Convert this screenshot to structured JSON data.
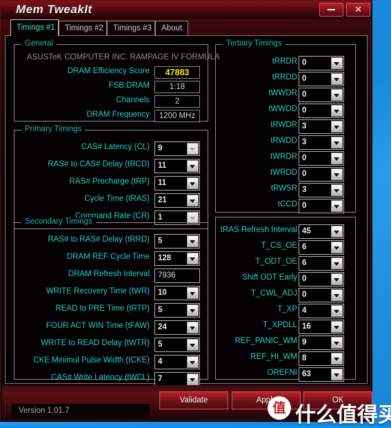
{
  "window": {
    "title": "Mem TweakIt",
    "minimize_label": "",
    "close_label": "✕",
    "version": "Version 1.01.7"
  },
  "tabs": [
    {
      "label": "Timings #1",
      "active": true
    },
    {
      "label": "Timings #2",
      "active": false
    },
    {
      "label": "Timings #3",
      "active": false
    },
    {
      "label": "About",
      "active": false
    }
  ],
  "general": {
    "legend": "General",
    "motherboard": "ASUSTeK COMPUTER INC.  RAMPAGE IV FORMULA",
    "rows": [
      {
        "label": "DRAM Efficiency Score",
        "value": "47883",
        "accent": true
      },
      {
        "label": "FSB:DRAM",
        "value": "1:18",
        "accent": false
      },
      {
        "label": "Channels",
        "value": "2",
        "accent": false
      },
      {
        "label": "DRAM Frequency",
        "value": "1200 MHz",
        "accent": false
      }
    ]
  },
  "primary": {
    "legend": "Primary Timings",
    "rows": [
      {
        "label": "CAS# Latency (CL)",
        "value": "9",
        "disabled": true
      },
      {
        "label": "RAS# to CAS# Delay (tRCD)",
        "value": "11",
        "disabled": false
      },
      {
        "label": "RAS# Precharge (tRP)",
        "value": "11",
        "disabled": false
      },
      {
        "label": "Cycle Time (tRAS)",
        "value": "21",
        "disabled": false
      },
      {
        "label": "Command Rate (CR)",
        "value": "1",
        "disabled": true
      }
    ]
  },
  "secondary": {
    "legend": "Secondary Timings",
    "rows": [
      {
        "label": "RAS# to RAS# Delay (tRRD)",
        "value": "5",
        "type": "combo"
      },
      {
        "label": "DRAM REF Cycle Time",
        "value": "128",
        "type": "combo"
      },
      {
        "label": "DRAM Refresh Interval",
        "value": "7936",
        "type": "text"
      },
      {
        "label": "WRITE Recovery Time (tWR)",
        "value": "10",
        "type": "combo"
      },
      {
        "label": "READ to PRE Time (tRTP)",
        "value": "5",
        "type": "combo"
      },
      {
        "label": "FOUR ACT WIN Time (tFAW)",
        "value": "24",
        "type": "combo"
      },
      {
        "label": "WRITE to READ Delay (tWTR)",
        "value": "5",
        "type": "combo"
      },
      {
        "label": "CKE Minimul Pulse Width (tCKE)",
        "value": "4",
        "type": "combo"
      },
      {
        "label": "CAS# Write Latency (tWCL)",
        "value": "7",
        "type": "combo"
      }
    ]
  },
  "tertiary": {
    "legend": "Tertiary Timings",
    "rows": [
      {
        "label": "tRRDR",
        "value": "0"
      },
      {
        "label": "tRRDD",
        "value": "0"
      },
      {
        "label": "tWWDR",
        "value": "0"
      },
      {
        "label": "tWWDD",
        "value": "0"
      },
      {
        "label": "tRWDR",
        "value": "3"
      },
      {
        "label": "tRWDD",
        "value": "3"
      },
      {
        "label": "tWRDR",
        "value": "0"
      },
      {
        "label": "tWRDD",
        "value": "0"
      },
      {
        "label": "tRWSR",
        "value": "3"
      },
      {
        "label": "tCCD",
        "value": "0"
      }
    ]
  },
  "misc": {
    "rows": [
      {
        "label": "tRAS Refresh Interval",
        "value": "45"
      },
      {
        "label": "T_CS_OE",
        "value": "6"
      },
      {
        "label": "T_ODT_OE",
        "value": "6"
      },
      {
        "label": "Shift ODT Early",
        "value": "0"
      },
      {
        "label": "T_CWL_ADJ",
        "value": "0"
      },
      {
        "label": "T_XP",
        "value": "4"
      },
      {
        "label": "T_XPDLL",
        "value": "16"
      },
      {
        "label": "REF_PANIC_WM",
        "value": "9"
      },
      {
        "label": "REF_HI_WM",
        "value": "8"
      },
      {
        "label": "OREFNI",
        "value": "63"
      }
    ]
  },
  "actions": {
    "validate": "Validate",
    "apply": "Apply",
    "ok": "OK"
  },
  "watermark": {
    "badge": "值",
    "text": "什么值得买"
  },
  "colors": {
    "accent_yellow": "#ffe400",
    "label_cyan": "#1fd0c4",
    "legend_cyan": "#18b6a8",
    "tab_active": "#2ee3b8",
    "frame_red": "#8d151c",
    "desktop_blue": "#1b8fe0"
  }
}
